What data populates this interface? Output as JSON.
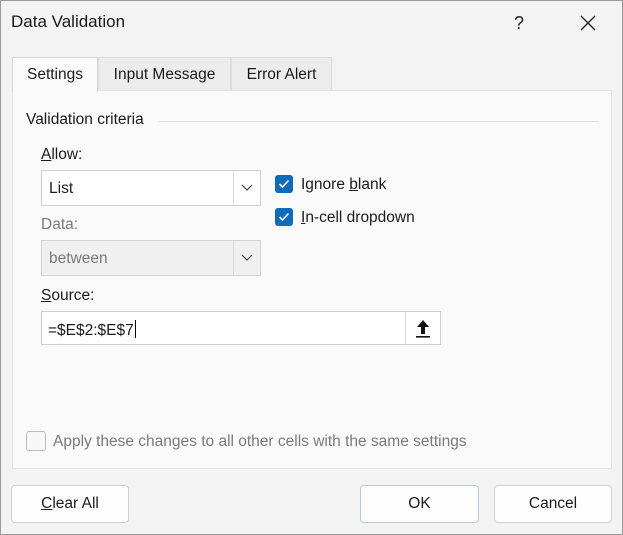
{
  "window": {
    "title": "Data Validation",
    "help_label": "?"
  },
  "tabs": [
    {
      "label": "Settings",
      "active": true
    },
    {
      "label": "Input Message",
      "active": false
    },
    {
      "label": "Error Alert",
      "active": false
    }
  ],
  "settings": {
    "group_label": "Validation criteria",
    "allow": {
      "label_key": "A",
      "label_rest": "llow:",
      "value": "List"
    },
    "data": {
      "label": "Data:",
      "value": "between",
      "enabled": false
    },
    "source": {
      "label_key": "S",
      "label_rest": "ource:",
      "value": "=$E$2:$E$7"
    },
    "ignore_blank": {
      "label_pre": "Ignore ",
      "label_key": "b",
      "label_rest": "lank",
      "checked": true
    },
    "incell_dropdown": {
      "label_key": "I",
      "label_rest": "n-cell dropdown",
      "checked": true
    },
    "apply_all": {
      "label": "Apply these changes to all other cells with the same settings",
      "checked": false,
      "enabled": false
    }
  },
  "buttons": {
    "clear_all_key": "C",
    "clear_all_rest": "lear All",
    "ok": "OK",
    "cancel": "Cancel"
  },
  "colors": {
    "accent": "#0f6cbd",
    "dialog_bg": "#f3f3f3",
    "panel_bg": "#fafafa"
  }
}
